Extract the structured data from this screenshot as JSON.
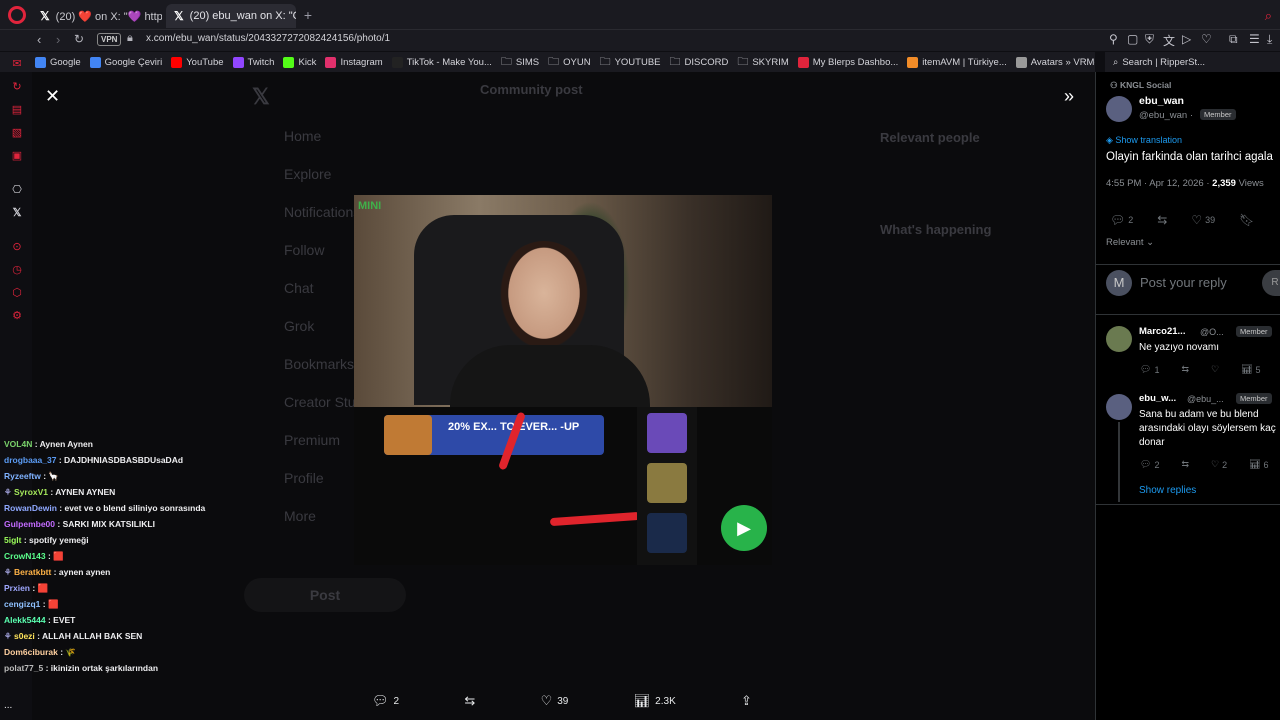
{
  "browser": {
    "tabs": [
      {
        "label": "(20) ❤️ on X: \"💜 https"
      },
      {
        "label": "(20) ebu_wan on X: \"Olayı"
      }
    ],
    "vpn_label": "VPN",
    "url": "x.com/ebu_wan/status/2043327272082424156/photo/1",
    "bookmarks": [
      {
        "label": "Google",
        "icon": "google-icon",
        "color": "#4285f4"
      },
      {
        "label": "Google Çeviri",
        "icon": "translate-icon",
        "color": "#4285f4"
      },
      {
        "label": "YouTube",
        "icon": "youtube-icon",
        "color": "#ff0000"
      },
      {
        "label": "Twitch",
        "icon": "twitch-icon",
        "color": "#9146ff"
      },
      {
        "label": "Kick",
        "icon": "kick-icon",
        "color": "#53fc18"
      },
      {
        "label": "Instagram",
        "icon": "instagram-icon",
        "color": "#e1306c"
      },
      {
        "label": "TikTok - Make You...",
        "icon": "tiktok-icon",
        "color": "#222222"
      },
      {
        "label": "SIMS",
        "icon": "folder-icon",
        "color": ""
      },
      {
        "label": "OYUN",
        "icon": "folder-icon",
        "color": ""
      },
      {
        "label": "YOUTUBE",
        "icon": "folder-icon",
        "color": ""
      },
      {
        "label": "DISCORD",
        "icon": "folder-icon",
        "color": ""
      },
      {
        "label": "SKYRIM",
        "icon": "folder-icon",
        "color": ""
      },
      {
        "label": "My Blerps Dashbo...",
        "icon": "blerp-icon",
        "color": "#e0243c"
      },
      {
        "label": "itemAVM | Türkiye...",
        "icon": "itemavm-icon",
        "color": "#f28c28"
      },
      {
        "label": "Avatars » VRMode...",
        "icon": "vrmodel-icon",
        "color": "#999999"
      }
    ],
    "bookmark_right": "Search | RipperSt..."
  },
  "background_page": {
    "header": "Community post",
    "nav": [
      "Home",
      "Explore",
      "Notifications",
      "Follow",
      "Chat",
      "Grok",
      "Bookmarks",
      "Creator Studio",
      "Premium",
      "Profile",
      "More"
    ],
    "post_button": "Post",
    "relevant_people": "Relevant people",
    "whats_happening": "What's happening"
  },
  "photo_bar": {
    "replies": "2",
    "likes": "39",
    "views": "2.3K"
  },
  "photo": {
    "promo_text": "20% EX... TO EVER... -UP",
    "cam_logo": "MINI"
  },
  "chat": [
    {
      "user": "VOL4N",
      "color": "#7ad36b",
      "msg": "Aynen Aynen",
      "badge": false
    },
    {
      "user": "drogbaaa_37",
      "color": "#5b9cf5",
      "msg": "DAJDHNIASDBASBDUsaDAd",
      "badge": false
    },
    {
      "user": "Ryzeeftw",
      "color": "#7fb2ff",
      "msg": "🦙",
      "badge": false
    },
    {
      "user": "SyroxV1",
      "color": "#a5e85b",
      "msg": "AYNEN AYNEN",
      "badge": true
    },
    {
      "user": "RowanDewin",
      "color": "#8fa8ff",
      "msg": "evet ve o blend siliniyo sonrasında",
      "badge": false
    },
    {
      "user": "Gulpembe00",
      "color": "#c36bff",
      "msg": "SARKI MIX KATSILIKLI",
      "badge": false
    },
    {
      "user": "5iglt",
      "color": "#9cff5b",
      "msg": "spotify yemeği",
      "badge": false
    },
    {
      "user": "CrowN143",
      "color": "#5bff8c",
      "msg": "🟥",
      "badge": false
    },
    {
      "user": "Beratkbtt",
      "color": "#ffb347",
      "msg": "aynen aynen",
      "badge": true
    },
    {
      "user": "Prxien",
      "color": "#9fa8ff",
      "msg": "🟥",
      "badge": false
    },
    {
      "user": "cengizq1",
      "color": "#8fc1ff",
      "msg": "🟥",
      "badge": false
    },
    {
      "user": "Alekk5444",
      "color": "#5bffb0",
      "msg": "EVET",
      "badge": false
    },
    {
      "user": "s0ezi",
      "color": "#ffe45b",
      "msg": "ALLAH ALLAH BAK SEN",
      "badge": true
    },
    {
      "user": "Dom6ciburak",
      "color": "#ffd0a0",
      "msg": "🌾",
      "badge": false
    },
    {
      "user": "polat77_5",
      "color": "#bbbbbb",
      "msg": "ikinizin ortak şarkılarından",
      "badge": false
    }
  ],
  "chat_more": "...",
  "right_panel": {
    "community": "KNGL Social",
    "author_name": "ebu_wan",
    "author_handle": "@ebu_wan ·",
    "author_badge": "Member",
    "show_translation": "Show translation",
    "post_text": "Olayin farkinda olan tarihci agala",
    "timestamp": "4:55 PM · Apr 12, 2026 ·",
    "views_count": "2,359",
    "views_label": "Views",
    "replies": "2",
    "likes": "39",
    "sort": "Relevant",
    "reply_avatar": "M",
    "reply_placeholder": "Post your reply",
    "reply_button": "R",
    "comments": [
      {
        "name": "Marco21...",
        "handle": "@O...",
        "badge": "Member",
        "text": "Ne yazıyo novamı",
        "replies": "1",
        "likes": "",
        "views": "5"
      },
      {
        "name": "ebu_w...",
        "handle": "@ebu_...",
        "badge": "Member",
        "text": "Sana bu adam ve bu blend arasındaki olayı söylersem kaç donar",
        "replies": "2",
        "likes": "2",
        "views": "6"
      }
    ],
    "show_replies": "Show replies"
  }
}
